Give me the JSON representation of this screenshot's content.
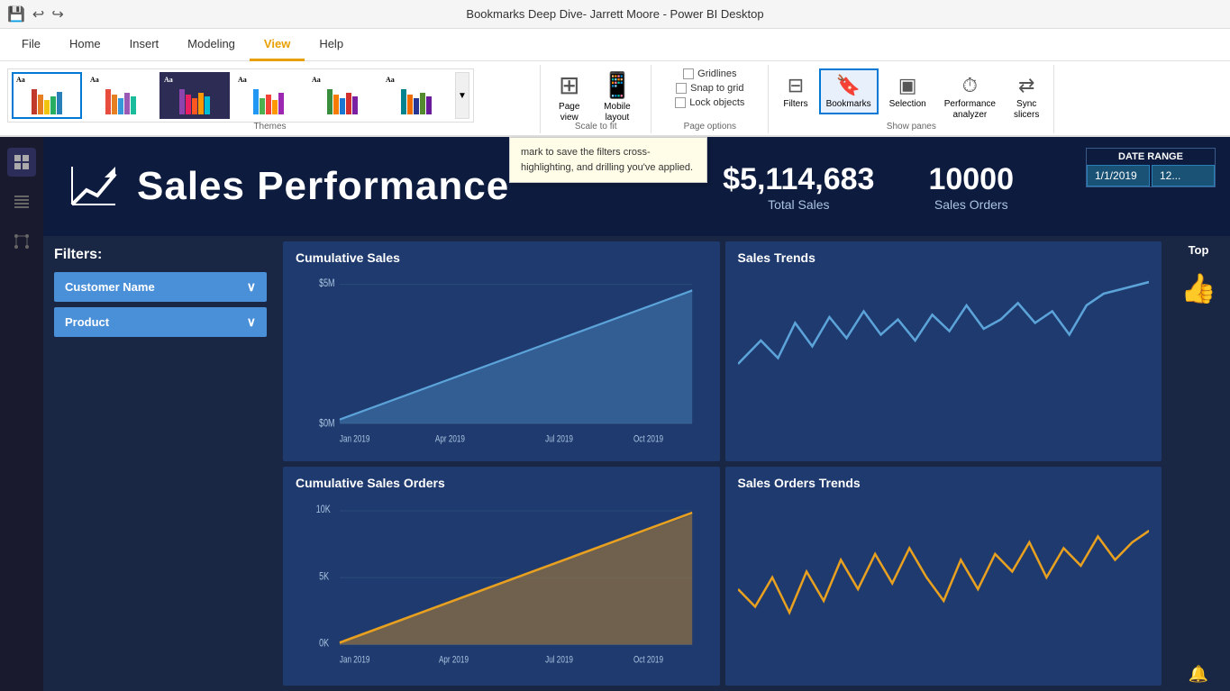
{
  "titleBar": {
    "title": "Bookmarks Deep Dive- Jarrett Moore - Power BI Desktop"
  },
  "ribbon": {
    "tabs": [
      "File",
      "Home",
      "Insert",
      "Modeling",
      "View",
      "Help"
    ],
    "activeTab": "View",
    "groups": {
      "themes": {
        "label": "Themes",
        "swatches": [
          {
            "label": "Aa",
            "colors": [
              "#c0392b",
              "#e67e22",
              "#f1c40f",
              "#27ae60",
              "#2980b9"
            ]
          },
          {
            "label": "Aa",
            "colors": [
              "#e74c3c",
              "#e67e22",
              "#3498db",
              "#9b59b6",
              "#1abc9c"
            ]
          },
          {
            "label": "Aa",
            "colors": [
              "#8e44ad",
              "#e91e63",
              "#ff5722",
              "#ff9800",
              "#00bcd4"
            ]
          },
          {
            "label": "Aa",
            "colors": [
              "#2196f3",
              "#4caf50",
              "#f44336",
              "#ff9800",
              "#9c27b0"
            ]
          },
          {
            "label": "Aa",
            "colors": [
              "#388e3c",
              "#f57c00",
              "#1976d2",
              "#d32f2f",
              "#7b1fa2"
            ]
          },
          {
            "label": "Aa",
            "colors": [
              "#00838f",
              "#ef6c00",
              "#283593",
              "#558b2f",
              "#6a1b9a"
            ]
          }
        ]
      },
      "scaleToFit": {
        "label": "Scale to fit",
        "pageViewLabel": "Page\nview",
        "mobileLayoutLabel": "Mobile\nlayout"
      },
      "pageOptions": {
        "label": "Page options",
        "options": [
          "Gridlines",
          "Snap to grid",
          "Lock objects"
        ]
      },
      "showPanes": {
        "label": "Show panes",
        "panes": [
          "Filters",
          "Bookmarks",
          "Selection",
          "Performance\nanalyzer",
          "Sync\nslicers"
        ]
      }
    }
  },
  "leftNav": {
    "icons": [
      "report-icon",
      "data-icon",
      "model-icon"
    ]
  },
  "dashboard": {
    "header": {
      "title": "Sales Performance",
      "totalSales": "$5,114,683",
      "totalSalesLabel": "Total Sales",
      "salesOrders": "10000",
      "salesOrdersLabel": "Sales Orders",
      "dateRangeLabel": "DATE RANGE",
      "dateStart": "1/1/2019",
      "dateEnd": "12..."
    },
    "filters": {
      "title": "Filters:",
      "items": [
        "Customer Name",
        "Product"
      ]
    },
    "charts": {
      "cumulativeSales": {
        "title": "Cumulative Sales",
        "yLabels": [
          "$5M",
          "$0M"
        ],
        "xLabels": [
          "Jan 2019",
          "Apr 2019",
          "Jul 2019",
          "Oct 2019"
        ]
      },
      "salesTrends": {
        "title": "Sales Trends"
      },
      "cumulativeOrders": {
        "title": "Cumulative Sales Orders",
        "yLabels": [
          "10K",
          "5K",
          "0K"
        ],
        "xLabels": [
          "Jan 2019",
          "Apr 2019",
          "Jul 2019",
          "Oct 2019"
        ]
      },
      "salesOrdersTrends": {
        "title": "Sales Orders Trends"
      }
    },
    "rightPanel": {
      "title": "Top"
    }
  },
  "tooltip": {
    "text": "mark to save the filters cross-highlighting, and drilling you've applied."
  },
  "highlightedPane": "Bookmarks"
}
